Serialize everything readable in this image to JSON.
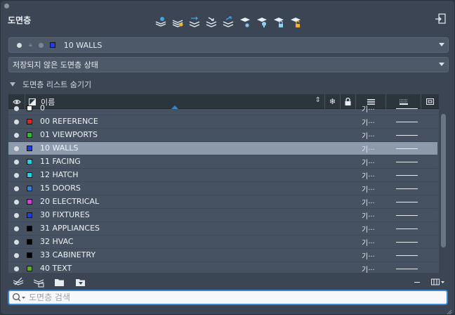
{
  "window": {
    "title": "도면층"
  },
  "toolbar": {
    "tools": [
      "new-layer-icon",
      "new-layer-vp-frozen-icon",
      "layer-states-icon",
      "isolate-icon",
      "unisolate-icon",
      "freeze-icon",
      "lock-icon",
      "unlock-icon",
      "layer-walk-icon"
    ]
  },
  "current_layer": {
    "name": "10 WALLS",
    "color": "#1d3fe0"
  },
  "layer_state": {
    "value": "저장되지 않은 도면층 상태"
  },
  "list_toggle": {
    "label": "도면층 리스트 숨기기"
  },
  "columns": {
    "name": "이름"
  },
  "layers": [
    {
      "name": "0",
      "color": "#ffffff",
      "material": "기···"
    },
    {
      "name": "00 REFERENCE",
      "color": "#e0261d",
      "material": "기···"
    },
    {
      "name": "01 VIEWPORTS",
      "color": "#22c22a",
      "material": "기···"
    },
    {
      "name": "10 WALLS",
      "color": "#1d3fe0",
      "material": "기···",
      "selected": true
    },
    {
      "name": "11 FACING",
      "color": "#19d6e8",
      "material": "기···"
    },
    {
      "name": "12 HATCH",
      "color": "#19d6e8",
      "material": "기···"
    },
    {
      "name": "15 DOORS",
      "color": "#2a83e0",
      "material": "기···"
    },
    {
      "name": "20 ELECTRICAL",
      "color": "#d63be0",
      "material": "기···"
    },
    {
      "name": "30 FIXTURES",
      "color": "#1d3fe0",
      "material": "기···"
    },
    {
      "name": "31 APPLIANCES",
      "color": "#000000",
      "material": "기···"
    },
    {
      "name": "32 HVAC",
      "color": "#000000",
      "material": "기···"
    },
    {
      "name": "33 CABINETRY",
      "color": "#000000",
      "material": "기···"
    },
    {
      "name": "40 TEXT",
      "color": "#5fae1f",
      "material": "기···"
    }
  ],
  "search": {
    "placeholder": "도면층 검색",
    "value": ""
  }
}
